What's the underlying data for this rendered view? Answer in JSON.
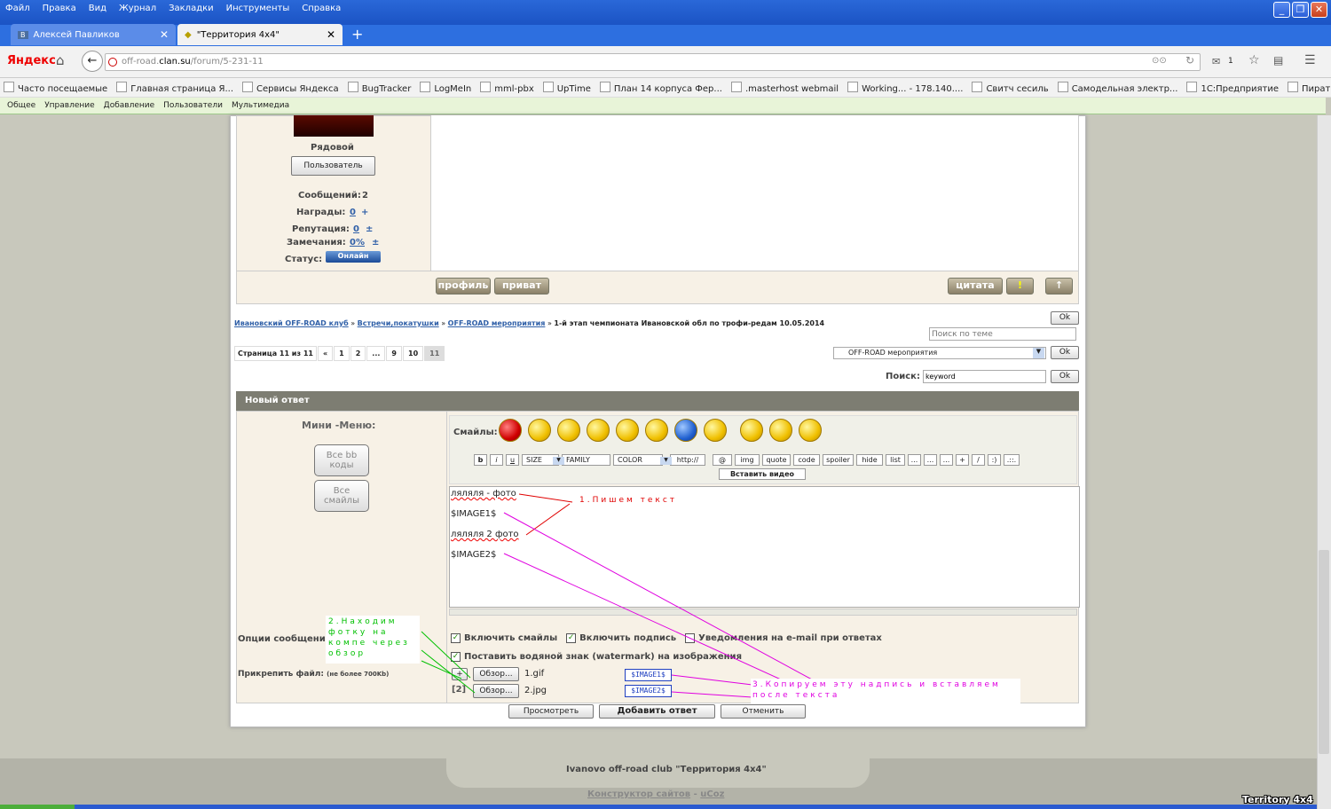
{
  "browser": {
    "menu": [
      "Файл",
      "Правка",
      "Вид",
      "Журнал",
      "Закладки",
      "Инструменты",
      "Справка"
    ],
    "tabs": [
      {
        "label": "Алексей Павликов"
      },
      {
        "label": "\"Территория 4x4\""
      }
    ],
    "url_host": "off-road.",
    "url_domain": "clan.su",
    "url_path": "/forum/5-231-11",
    "logo": "Яндекс",
    "mail_count": "1",
    "bookmarks": [
      "Часто посещаемые",
      "Главная страница Я...",
      "Сервисы Яндекса",
      "BugTracker",
      "LogMeIn",
      "mml-pbx",
      "UpTime",
      "План 14 корпуса Фер...",
      ".masterhost webmail",
      "Working... - 178.140....",
      "Свитч сесиль",
      "Самодельная электр...",
      "1С:Предприятие",
      "Пираты-онлайн Инф..."
    ],
    "ucoz_bar": [
      "Общее",
      "Управление",
      "Добавление",
      "Пользователи",
      "Мультимедиа"
    ]
  },
  "user": {
    "rank": "Рядовой",
    "group": "Пользователь",
    "messages_label": "Сообщений:",
    "messages": "2",
    "awards_label": "Награды:",
    "awards": "0",
    "reputation_label": "Репутация:",
    "reputation": "0",
    "warnings_label": "Замечания:",
    "warnings": "0%",
    "status_label": "Статус:",
    "status": "Онлайн",
    "profile_btn": "профиль",
    "private_btn": "приват",
    "quote_btn": "цитата"
  },
  "breadcrumb": {
    "items": [
      "Ивановский OFF-ROAD клуб",
      "Встречи,покатушки",
      "OFF-ROAD мероприятия"
    ],
    "current": "1-й этап чемпионата Ивановской обл по трофи-редам 10.05.2014",
    "sep": "»"
  },
  "topic_search_placeholder": "Поиск по теме",
  "ok": "Ok",
  "pager": {
    "label": "Страница 11 из 11",
    "pages": [
      "«",
      "1",
      "2",
      "...",
      "9",
      "10",
      "11"
    ]
  },
  "forum_select": "OFF-ROAD мероприятия",
  "search": {
    "label": "Поиск:",
    "value": "keyword"
  },
  "reply": {
    "title": "Новый ответ",
    "mini_menu": "Мини -Меню:",
    "all_bb": "Все bb коды",
    "all_smiles": "Все смайлы",
    "smiles_label": "Смайлы:",
    "toolbar": [
      "b",
      "i",
      "u",
      "SIZE",
      "FAMILY",
      "COLOR",
      "http://",
      "@",
      "img",
      "quote",
      "code",
      "spoiler",
      "hide",
      "list",
      "...",
      "...",
      "...",
      "+",
      "/",
      ":)",
      ".::."
    ],
    "insert_video": "Вставить видео",
    "text_lines": [
      "ляляля - фото",
      "$IMAGE1$",
      "ляляля 2 фото",
      "$IMAGE2$"
    ],
    "options_label": "Опции сообщения",
    "opt_smiles": "Включить смайлы",
    "opt_sign": "Включить подпись",
    "opt_email": "Уведомления на e-mail при ответах",
    "opt_watermark": "Поставить водяной знак (watermark) на изображения",
    "attach_label": "Прикрепить файл:",
    "attach_note": "(не более 700Kb)",
    "browse": "Обзор...",
    "file1": "1.gif",
    "file2": "2.jpg",
    "tag1": "$IMAGE1$",
    "tag2": "$IMAGE2$",
    "index2": "[2]",
    "plus": "+",
    "preview": "Просмотреть",
    "submit": "Добавить ответ",
    "cancel": "Отменить"
  },
  "annotations": {
    "a1": "1.Пишем текст",
    "a2": "2.Находим фотку на компе через обзор",
    "a3": "3.Копируем эту надпись и вставляем после текста"
  },
  "footer": {
    "site": "Ivanovo off-road club \"Территория 4x4\"",
    "constructor": "Конструктор сайтов",
    "dash": "-",
    "ucoz": "uCoz",
    "watermark": "Territory 4x4"
  },
  "colors": {
    "annotation1": "#e00000",
    "annotation2": "#00c000",
    "annotation3": "#e000e0",
    "titlebar": "#1b53c4"
  }
}
